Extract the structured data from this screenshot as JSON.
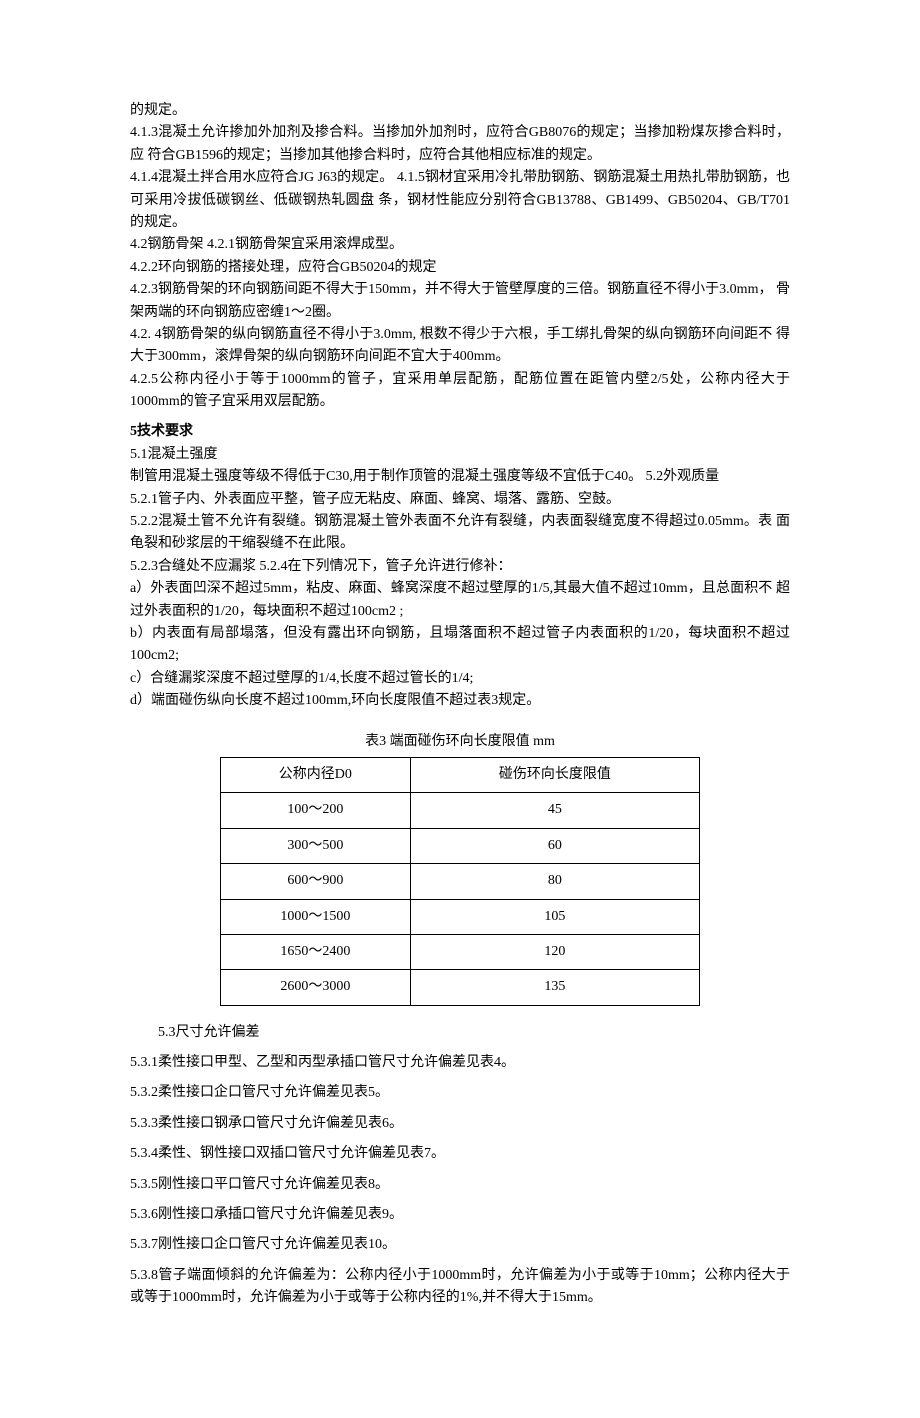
{
  "paragraphs": {
    "p1": "的规定。",
    "p2": "4.1.3混凝土允许掺加外加剂及掺合料。当掺加外加剂时，应符合GB8076的规定；当掺加粉煤灰掺合料时，应 符合GB1596的规定；当掺加其他掺合料时，应符合其他相应标准的规定。",
    "p3": "4.1.4混凝土拌合用水应符合JG J63的规定。 4.1.5钢材宜采用冷扎带肋钢筋、钢筋混凝土用热扎带肋钢筋，也可采用冷拔低碳钢丝、低碳钢热轧圆盘 条，钢材性能应分别符合GB13788、GB1499、GB50204、GB/T701的规定。",
    "p4": "4.2钢筋骨架 4.2.1钢筋骨架宜采用滚焊成型。",
    "p5": "4.2.2环向钢筋的搭接处理，应符合GB50204的规定",
    "p6": "4.2.3钢筋骨架的环向钢筋间距不得大于150mm，并不得大于管壁厚度的三倍。钢筋直径不得小于3.0mm， 骨架两端的环向钢筋应密缠1〜2圈。",
    "p7": "4.2. 4钢筋骨架的纵向钢筋直径不得小于3.0mm, 根数不得少于六根，手工绑扎骨架的纵向钢筋环向间距不 得大于300mm，滚焊骨架的纵向钢筋环向间距不宜大于400mm。",
    "p8": "4.2.5公称内径小于等于1000mm的管子，宜采用单层配筋，配筋位置在距管内壁2/5处，公称内径大于 1000mm的管子宜采用双层配筋。",
    "h5": "5技术要求",
    "p9": "5.1混凝土强度",
    "p10": "制管用混凝土强度等级不得低于C30,用于制作顶管的混凝土强度等级不宜低于C40。 5.2外观质量",
    "p11": "5.2.1管子内、外表面应平整，管子应无粘皮、麻面、蜂窝、塌落、露筋、空鼓。",
    "p12": "5.2.2混凝土管不允许有裂缝。钢筋混凝土管外表面不允许有裂缝，内表面裂缝宽度不得超过0.05mm。表 面龟裂和砂浆层的干缩裂缝不在此限。",
    "p13": "5.2.3合缝处不应漏浆 5.2.4在下列情况下，管子允许进行修补：",
    "p14": "a）外表面凹深不超过5mm，粘皮、麻面、蜂窝深度不超过壁厚的1/5,其最大值不超过10mm，且总面积不 超过外表面积的1/20，每块面积不超过100cm2 ;",
    "p15": "b）内表面有局部塌落，但没有露出环向钢筋，且塌落面积不超过管子内表面积的1/20，每块面积不超过100cm2;",
    "p16": "c）合缝漏浆深度不超过壁厚的1/4,长度不超过管长的1/4;",
    "p17": "d）端面碰伤纵向长度不超过100mm,环向长度限值不超过表3规定。",
    "table3_title": "表3 端面碰伤环向长度限值 mm",
    "p53": "5.3尺寸允许偏差",
    "p531": "5.3.1柔性接口甲型、乙型和丙型承插口管尺寸允许偏差见表4。",
    "p532": "5.3.2柔性接口企口管尺寸允许偏差见表5。",
    "p533": "5.3.3柔性接口钢承口管尺寸允许偏差见表6。",
    "p534": "5.3.4柔性、钢性接口双插口管尺寸允许偏差见表7。",
    "p535": "5.3.5刚性接口平口管尺寸允许偏差见表8。",
    "p536": "5.3.6刚性接口承插口管尺寸允许偏差见表9。",
    "p537": "5.3.7刚性接口企口管尺寸允许偏差见表10。",
    "p538": "5.3.8管子端面倾斜的允许偏差为：公称内径小于1000mm时，允许偏差为小于或等于10mm；公称内径大于 或等于1000mm时，允许偏差为小于或等于公称内径的1%,并不得大于15mm。"
  },
  "table3": {
    "headers": {
      "col1": "公称内径D0",
      "col2": "碰伤环向长度限值"
    },
    "rows": [
      {
        "c1": "100〜200",
        "c2": "45"
      },
      {
        "c1": "300〜500",
        "c2": "60"
      },
      {
        "c1": "600〜900",
        "c2": "80"
      },
      {
        "c1": "1000〜1500",
        "c2": "105"
      },
      {
        "c1": "1650〜2400",
        "c2": "120"
      },
      {
        "c1": "2600〜3000",
        "c2": "135"
      }
    ]
  }
}
